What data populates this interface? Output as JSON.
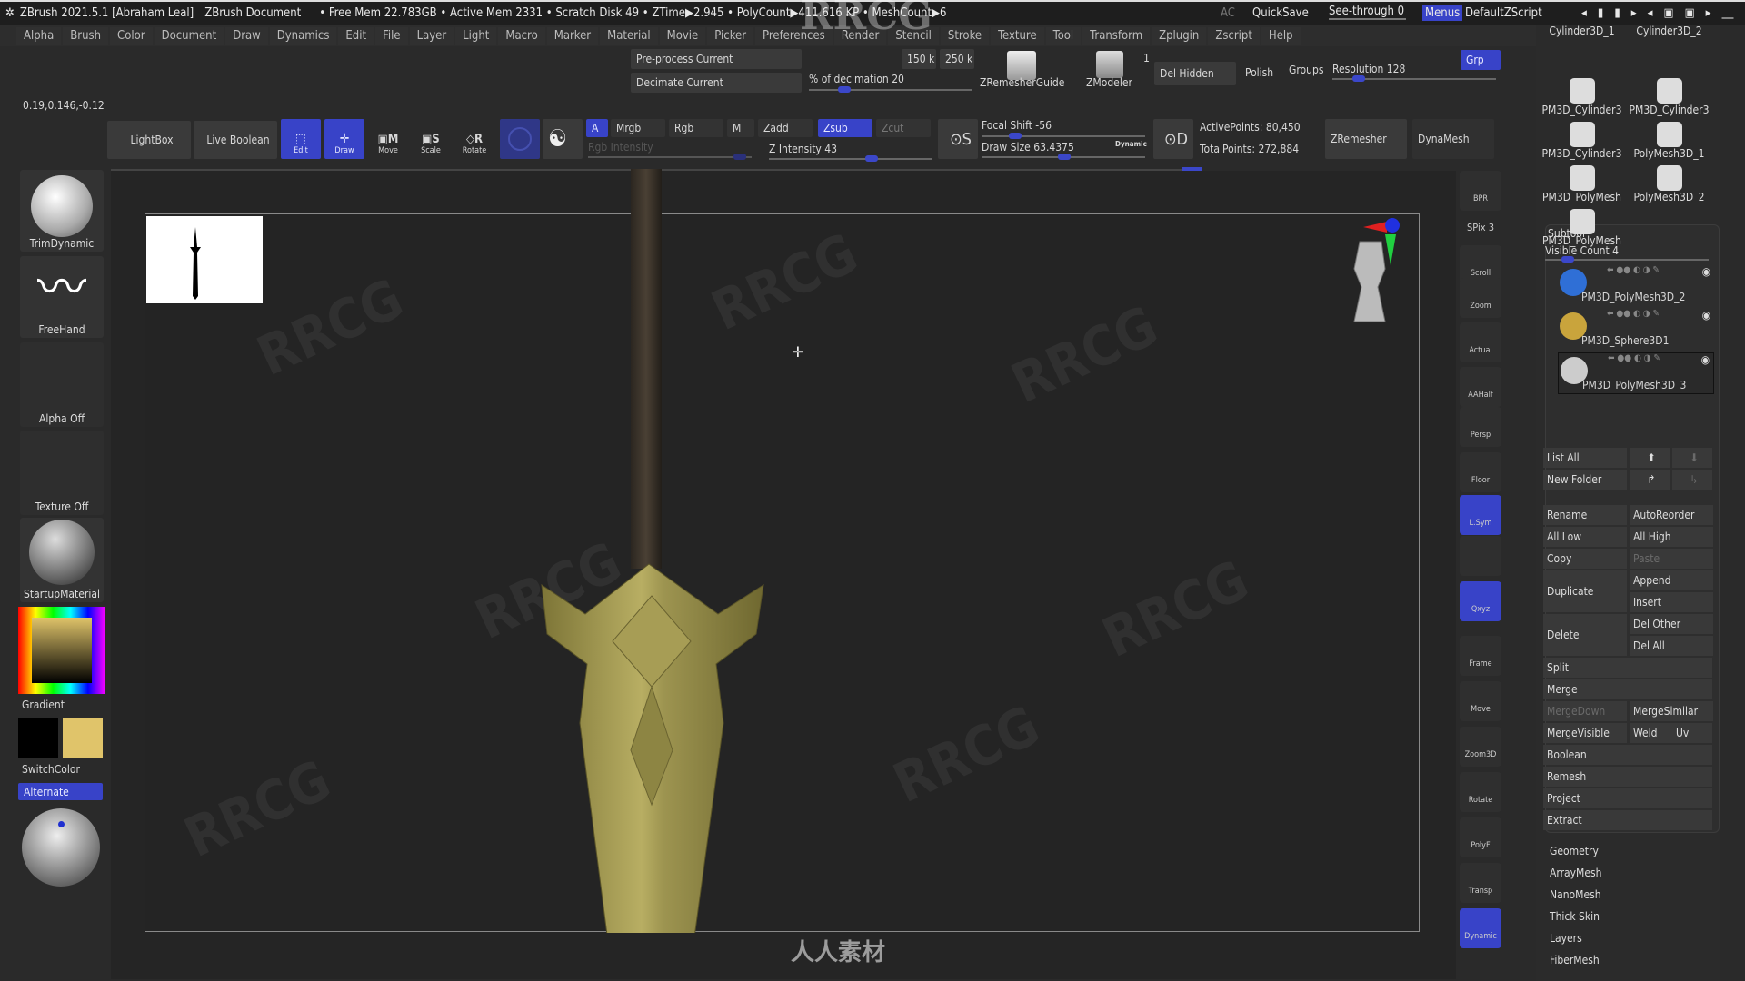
{
  "titlebar": {
    "title": "ZBrush 2021.5.1 [Abraham Leal]",
    "document": "ZBrush Document",
    "stats": "• Free Mem 22.783GB • Active Mem 2331 • Scratch Disk 49 • ZTime▶2.945 • PolyCount▶411.616 KP • MeshCount▶6",
    "ac": "AC",
    "quicksave": "QuickSave",
    "see_through": "See-through  0",
    "see_through_value": 0,
    "menus": "Menus",
    "default_zscript": "DefaultZScript"
  },
  "menus": [
    "Alpha",
    "Brush",
    "Color",
    "Document",
    "Draw",
    "Dynamics",
    "Edit",
    "File",
    "Layer",
    "Light",
    "Macro",
    "Marker",
    "Material",
    "Movie",
    "Picker",
    "Preferences",
    "Render",
    "Stencil",
    "Stroke",
    "Texture",
    "Tool",
    "Transform",
    "Zplugin",
    "Zscript",
    "Help"
  ],
  "topbar": {
    "coords": "0.19,0.146,-0.12",
    "preprocess": "Pre-process Current",
    "decimate": "Decimate Current",
    "k150": "150 k",
    "k250": "250 k",
    "decimation": "% of decimation 20",
    "decimation_value": 20,
    "zremesher_guide": "ZRemesherGuide",
    "zmodeler": "ZModeler",
    "zmodeler_count": "1",
    "del_hidden": "Del Hidden",
    "polish": "Polish",
    "groups": "Groups",
    "resolution": "Resolution 128",
    "resolution_value": 128,
    "grp": "Grp"
  },
  "toolbar": {
    "lightbox": "LightBox",
    "live_boolean": "Live Boolean",
    "edit": "Edit",
    "draw": "Draw",
    "move": "Move",
    "scale": "Scale",
    "rotate": "Rotate",
    "a": "A",
    "mrgb": "Mrgb",
    "rgb": "Rgb",
    "m": "M",
    "rgb_intensity": "Rgb Intensity",
    "zadd": "Zadd",
    "zsub": "Zsub",
    "zcut": "Zcut",
    "z_intensity": "Z Intensity 43",
    "z_intensity_value": 43,
    "focal_shift": "Focal Shift -56",
    "focal_shift_value": -56,
    "draw_size": "Draw Size 63.4375",
    "draw_size_value": 63.4375,
    "dynamic": "Dynamic",
    "active_points": "ActivePoints: 80,450",
    "total_points": "TotalPoints: 272,884",
    "zremesher": "ZRemesher",
    "dynamesh": "DynaMesh"
  },
  "left_shelf": {
    "brush": "TrimDynamic",
    "stroke": "FreeHand",
    "alpha": "Alpha Off",
    "texture": "Texture Off",
    "material": "StartupMaterial",
    "gradient": "Gradient",
    "switchcolor": "SwitchColor",
    "alternate": "Alternate",
    "colors": {
      "primary": "#000000",
      "secondary": "#e0c46a"
    }
  },
  "right_shelf": [
    {
      "label": "BPR"
    },
    {
      "label": "SPix 3"
    },
    {
      "label": "Scroll"
    },
    {
      "label": "Zoom"
    },
    {
      "label": "Actual"
    },
    {
      "label": "AAHalf"
    },
    {
      "label": "Persp"
    },
    {
      "label": "Floor"
    },
    {
      "label": "L.Sym",
      "active": true
    },
    {
      "label": ""
    },
    {
      "label": "Qxyz",
      "active": true
    },
    {
      "label": "Frame"
    },
    {
      "label": "Move"
    },
    {
      "label": "Zoom3D"
    },
    {
      "label": "Rotate"
    },
    {
      "label": "PolyF"
    },
    {
      "label": "Transp"
    },
    {
      "label": "Dynamic",
      "active": true
    }
  ],
  "tools": [
    "Cylinder3D_1",
    "Cylinder3D_2",
    "PM3D_Cylinder3",
    "PM3D_Cylinder3",
    "PM3D_Cylinder3",
    "PolyMesh3D_1",
    "PM3D_PolyMesh",
    "PolyMesh3D_2",
    "PM3D_PolyMesh"
  ],
  "subtool": {
    "title": "Subtool",
    "visible_count": "Visible Count 4",
    "visible_count_value": 4,
    "items": [
      {
        "name": "PM3D_PolyMesh3D_2",
        "color": "#2f6fd6"
      },
      {
        "name": "PM3D_Sphere3D1",
        "color": "#c9a43c"
      },
      {
        "name": "PM3D_PolyMesh3D_3",
        "color": "#cccccc",
        "selected": true
      }
    ],
    "list_all": "List All",
    "new_folder": "New Folder",
    "rename": "Rename",
    "autoreorder": "AutoReorder",
    "all_low": "All Low",
    "all_high": "All High",
    "copy": "Copy",
    "paste": "Paste",
    "duplicate": "Duplicate",
    "append": "Append",
    "insert": "Insert",
    "delete": "Delete",
    "del_other": "Del Other",
    "del_all": "Del All",
    "split": "Split",
    "merge": "Merge",
    "mergedown": "MergeDown",
    "mergesimilar": "MergeSimilar",
    "mergevisible": "MergeVisible",
    "weld": "Weld",
    "uv": "Uv",
    "boolean": "Boolean",
    "remesh": "Remesh",
    "project": "Project",
    "extract": "Extract"
  },
  "sections": [
    "Geometry",
    "ArrayMesh",
    "NanoMesh",
    "Thick Skin",
    "Layers",
    "FiberMesh"
  ],
  "watermark": {
    "logo": "RRCG",
    "cn": "人人素材"
  }
}
